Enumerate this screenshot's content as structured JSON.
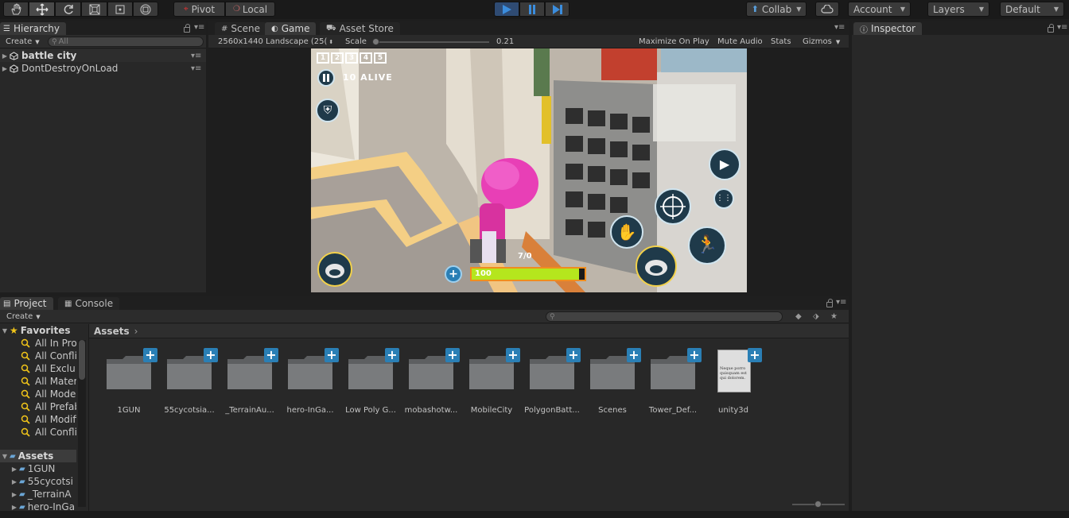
{
  "toolbar": {
    "pivot_label": "Pivot",
    "local_label": "Local",
    "collab_label": "Collab",
    "account_label": "Account",
    "layers_label": "Layers",
    "layout_label": "Default"
  },
  "hierarchy": {
    "tab_label": "Hierarchy",
    "create_label": "Create",
    "search_placeholder": "All",
    "scenes": [
      {
        "name": "battle city"
      },
      {
        "name": "DontDestroyOnLoad"
      }
    ]
  },
  "center": {
    "tabs": [
      {
        "label": "Scene"
      },
      {
        "label": "Game"
      },
      {
        "label": "Asset Store"
      }
    ],
    "resolution_label": "2560x1440 Landscape (25(",
    "scale_label": "Scale",
    "scale_value": "0.21",
    "maximize_label": "Maximize On Play",
    "mute_label": "Mute Audio",
    "stats_label": "Stats",
    "gizmos_label": "Gizmos"
  },
  "game_hud": {
    "weapon_slots": [
      "1",
      "2",
      "3",
      "4",
      "5"
    ],
    "alive_text": "10 ALIVE",
    "ammo_text": "7/0",
    "health_text": "100",
    "health_fraction": 0.95
  },
  "inspector": {
    "tab_label": "Inspector"
  },
  "project": {
    "tabs": [
      {
        "label": "Project"
      },
      {
        "label": "Console"
      }
    ],
    "create_label": "Create",
    "favorites_label": "Favorites",
    "favorites": [
      {
        "label": "All In Pro"
      },
      {
        "label": "All Confli"
      },
      {
        "label": "All Exclu"
      },
      {
        "label": "All Materi"
      },
      {
        "label": "All Model"
      },
      {
        "label": "All Prefab"
      },
      {
        "label": "All Modifi"
      },
      {
        "label": "All Confli"
      }
    ],
    "assets_root_label": "Assets",
    "asset_tree": [
      {
        "label": "1GUN"
      },
      {
        "label": "55cycotsi"
      },
      {
        "label": "_TerrainA"
      },
      {
        "label": "hero-InGa"
      }
    ],
    "breadcrumb": "Assets",
    "files": [
      {
        "label": "1GUN"
      },
      {
        "label": "55cycotsia..."
      },
      {
        "label": "_TerrainAu..."
      },
      {
        "label": "hero-InGa..."
      },
      {
        "label": "Low Poly G..."
      },
      {
        "label": "mobashotw..."
      },
      {
        "label": "MobileCity"
      },
      {
        "label": "PolygonBatt..."
      },
      {
        "label": "Scenes"
      },
      {
        "label": "Tower_Def..."
      },
      {
        "label": "unity3d"
      }
    ],
    "doc_preview_text": "Neque porro quisquam est qui dolorem."
  },
  "colors": {
    "accent_blue": "#2a7fb5",
    "play_active": "#2f4b73",
    "health_green": "#b5e61d"
  }
}
